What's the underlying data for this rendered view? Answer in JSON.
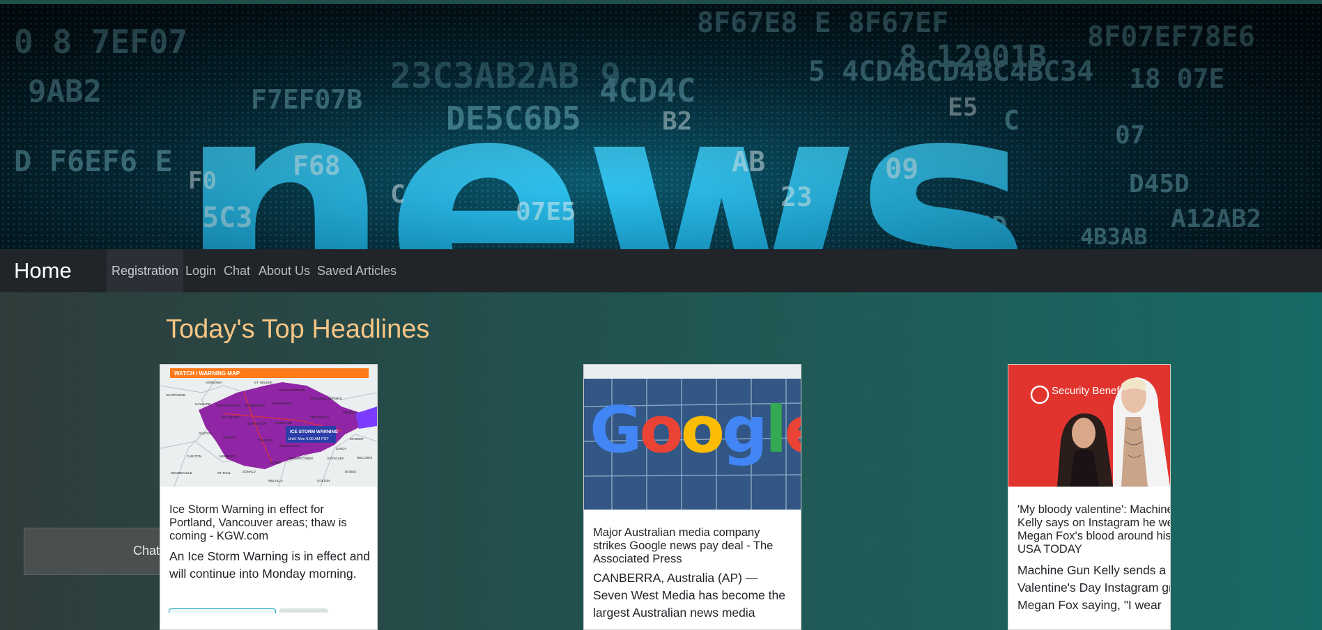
{
  "banner": {
    "word": "news",
    "alt": "news banner"
  },
  "navbar": {
    "brand": "Home",
    "items": [
      "Registration",
      "Login",
      "Chat",
      "About Us",
      "Saved Articles"
    ]
  },
  "main": {
    "heading": "Today's Top Headlines",
    "chat_label": "Chat",
    "cards": [
      {
        "title": "Ice Storm Warning in effect for Portland, Vancouver areas; thaw is coming - KGW.com",
        "description": "An Ice Storm Warning is in effect and will continue into Monday morning.",
        "image": "ice-storm-warning-map",
        "image_text": {
          "header": "WATCH / WARNING MAP",
          "warning_label": "ICE STORM WARNING",
          "warning_until": "Until: Mon 6:00 AM PST",
          "places": [
            "VERNONIA",
            "ST. HELENS",
            "BATTLE GROUND",
            "SCAPPOOSE",
            "CRESWELL HEIGHTS",
            "HAYWARD",
            "MOUNTAINDALE",
            "FOLKENBERG",
            "VANCOUVER",
            "TROUTDALE",
            "HILLSBORO",
            "BEAVERTON",
            "PORTLAND",
            "GASTON",
            "MIDWAY",
            "TUALATIN",
            "OREGON CITY",
            "BEAVER CREEK",
            "ESTACADA",
            "CARLTON",
            "NEWBERG",
            "CANBY",
            "MCMINNVILLE",
            "ST. PAUL",
            "DONALD",
            "MOLALLA",
            "COLTON",
            "DODGE",
            "MARMOT",
            "PRINDLE",
            "WELCHES",
            "SANDY"
          ]
        }
      },
      {
        "title": "Major Australian media company strikes Google news pay deal - The Associated Press",
        "description": "CANBERRA, Australia (AP) — Seven West Media has become the largest Australian news media",
        "image": "google-building-logo",
        "image_text": {
          "logo": "Google"
        }
      },
      {
        "title": "'My bloody valentine': Machine Gun Kelly says on Instagram he wears Megan Fox's blood around his neck - USA TODAY",
        "description": "Machine Gun Kelly sends a Valentine's Day Instagram greeting to Megan Fox saying, \"I wear",
        "image": "celebrity-couple-photo",
        "image_text": {
          "backdrop": "Security Benefit"
        }
      }
    ]
  },
  "colors": {
    "heading": "#f6c586",
    "navbar": "#212529",
    "accent": "#17a2b8",
    "neon_blue": "#25c8f0"
  }
}
